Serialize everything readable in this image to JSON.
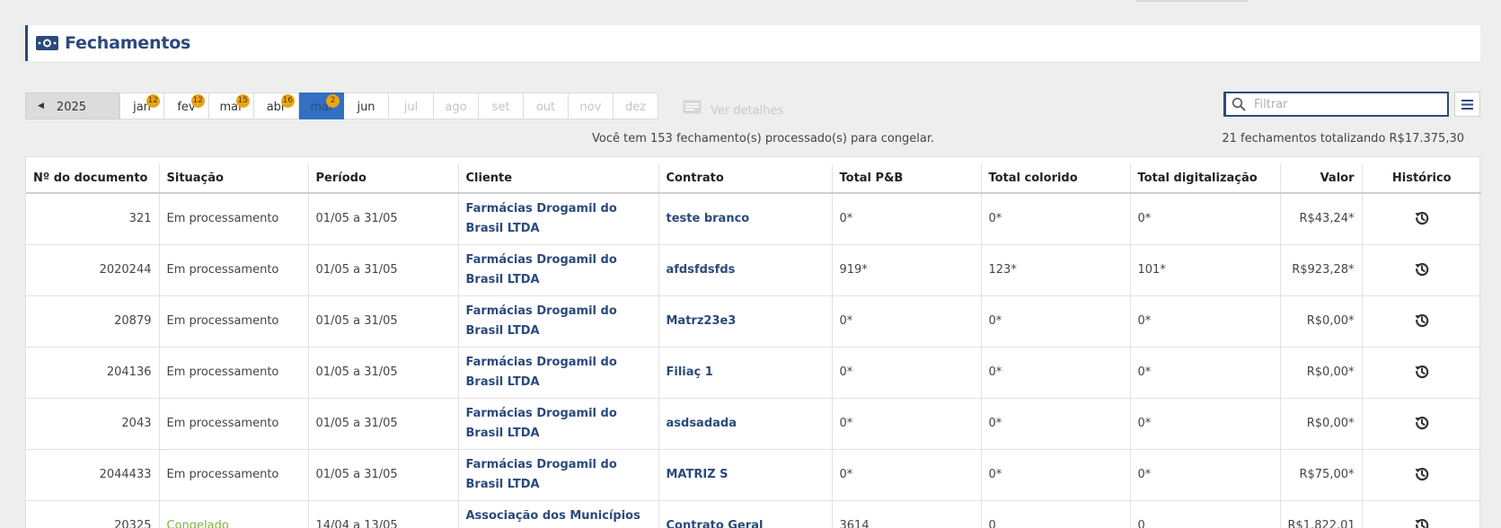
{
  "page": {
    "title": "Fechamentos",
    "title_icon": "money-icon"
  },
  "months_bar": {
    "year": "2025",
    "months": [
      {
        "label": "jan",
        "badge": "12",
        "state": "normal"
      },
      {
        "label": "fev",
        "badge": "12",
        "state": "normal"
      },
      {
        "label": "mar",
        "badge": "15",
        "state": "normal"
      },
      {
        "label": "abr",
        "badge": "16",
        "state": "normal"
      },
      {
        "label": "mai",
        "badge": "2",
        "state": "active"
      },
      {
        "label": "jun",
        "badge": "",
        "state": "normal"
      },
      {
        "label": "jul",
        "badge": "",
        "state": "disabled"
      },
      {
        "label": "ago",
        "badge": "",
        "state": "disabled"
      },
      {
        "label": "set",
        "badge": "",
        "state": "disabled"
      },
      {
        "label": "out",
        "badge": "",
        "state": "disabled"
      },
      {
        "label": "nov",
        "badge": "",
        "state": "disabled"
      },
      {
        "label": "dez",
        "badge": "",
        "state": "disabled"
      }
    ],
    "details_label": "Ver detalhes"
  },
  "filter": {
    "placeholder": "Filtrar",
    "value": ""
  },
  "info": {
    "pending_message": "Você tem 153 fechamento(s) processado(s) para congelar.",
    "summary": "21 fechamentos totalizando R$17.375,30"
  },
  "table": {
    "columns": [
      "Nº do documento",
      "Situação",
      "Período",
      "Cliente",
      "Contrato",
      "Total P&B",
      "Total colorido",
      "Total digitalização",
      "Valor",
      "Histórico"
    ],
    "rows": [
      {
        "doc": "321",
        "status": "Em processamento",
        "period": "01/05 a 31/05",
        "client": "Farmácias Drogamil do Brasil LTDA",
        "contract": "teste branco",
        "pb": "0*",
        "color": "0*",
        "scan": "0*",
        "value": "R$43,24*"
      },
      {
        "doc": "2020244",
        "status": "Em processamento",
        "period": "01/05 a 31/05",
        "client": "Farmácias Drogamil do Brasil LTDA",
        "contract": "afdsfdsfds",
        "pb": "919*",
        "color": "123*",
        "scan": "101*",
        "value": "R$923,28*"
      },
      {
        "doc": "20879",
        "status": "Em processamento",
        "period": "01/05 a 31/05",
        "client": "Farmácias Drogamil do Brasil LTDA",
        "contract": "Matrz23e3",
        "pb": "0*",
        "color": "0*",
        "scan": "0*",
        "value": "R$0,00*"
      },
      {
        "doc": "204136",
        "status": "Em processamento",
        "period": "01/05 a 31/05",
        "client": "Farmácias Drogamil do Brasil LTDA",
        "contract": "Filiaç 1",
        "pb": "0*",
        "color": "0*",
        "scan": "0*",
        "value": "R$0,00*"
      },
      {
        "doc": "2043",
        "status": "Em processamento",
        "period": "01/05 a 31/05",
        "client": "Farmácias Drogamil do Brasil LTDA",
        "contract": "asdsadada",
        "pb": "0*",
        "color": "0*",
        "scan": "0*",
        "value": "R$0,00*"
      },
      {
        "doc": "2044433",
        "status": "Em processamento",
        "period": "01/05 a 31/05",
        "client": "Farmácias Drogamil do Brasil LTDA",
        "contract": "MATRIZ S",
        "pb": "0*",
        "color": "0*",
        "scan": "0*",
        "value": "R$75,00*"
      },
      {
        "doc": "20325",
        "status": "Congelado",
        "period": "14/04 a 13/05",
        "client": "Associação dos Municípios da",
        "contract": "Contrato Geral",
        "pb": "3614",
        "color": "0",
        "scan": "0",
        "value": "R$1.822,01"
      }
    ]
  },
  "colors": {
    "brand_blue": "#2a4a7c",
    "active_month": "#3170c2",
    "badge_orange": "#e8a317",
    "frozen_green": "#7cb342"
  }
}
